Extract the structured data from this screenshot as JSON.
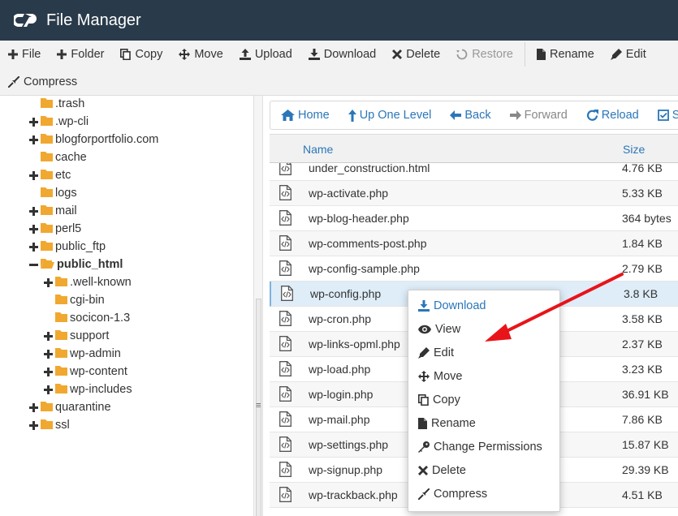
{
  "app": {
    "title": "File Manager"
  },
  "toolbar": {
    "row1": [
      {
        "icon": "plus-icon",
        "label": "File"
      },
      {
        "icon": "plus-icon",
        "label": "Folder"
      },
      {
        "icon": "copy-icon",
        "label": "Copy"
      },
      {
        "icon": "move-icon",
        "label": "Move"
      },
      {
        "icon": "upload-icon",
        "label": "Upload"
      },
      {
        "icon": "download-icon",
        "label": "Download"
      },
      {
        "icon": "close-icon",
        "label": "Delete"
      },
      {
        "icon": "restore-icon",
        "label": "Restore",
        "disabled": true
      },
      {
        "icon": "file-icon",
        "label": "Rename"
      },
      {
        "icon": "pencil-icon",
        "label": "Edit"
      }
    ],
    "row2": [
      {
        "icon": "compress-icon",
        "label": "Compress"
      }
    ]
  },
  "tree": [
    {
      "label": ".trash",
      "level": 0,
      "toggle": "none"
    },
    {
      "label": ".wp-cli",
      "level": 0,
      "toggle": "plus"
    },
    {
      "label": "blogforportfolio.com",
      "level": 0,
      "toggle": "plus"
    },
    {
      "label": "cache",
      "level": 0,
      "toggle": "none"
    },
    {
      "label": "etc",
      "level": 0,
      "toggle": "plus"
    },
    {
      "label": "logs",
      "level": 0,
      "toggle": "none"
    },
    {
      "label": "mail",
      "level": 0,
      "toggle": "plus"
    },
    {
      "label": "perl5",
      "level": 0,
      "toggle": "plus"
    },
    {
      "label": "public_ftp",
      "level": 0,
      "toggle": "plus"
    },
    {
      "label": "public_html",
      "level": 0,
      "toggle": "minus",
      "bold": true,
      "open": true
    },
    {
      "label": ".well-known",
      "level": 1,
      "toggle": "plus"
    },
    {
      "label": "cgi-bin",
      "level": 1,
      "toggle": "none"
    },
    {
      "label": "socicon-1.3",
      "level": 1,
      "toggle": "none"
    },
    {
      "label": "support",
      "level": 1,
      "toggle": "plus"
    },
    {
      "label": "wp-admin",
      "level": 1,
      "toggle": "plus"
    },
    {
      "label": "wp-content",
      "level": 1,
      "toggle": "plus"
    },
    {
      "label": "wp-includes",
      "level": 1,
      "toggle": "plus"
    },
    {
      "label": "quarantine",
      "level": 0,
      "toggle": "plus"
    },
    {
      "label": "ssl",
      "level": 0,
      "toggle": "plus"
    }
  ],
  "nav": [
    {
      "icon": "home-icon",
      "label": "Home"
    },
    {
      "icon": "up-arrow-icon",
      "label": "Up One Level"
    },
    {
      "icon": "back-arrow-icon",
      "label": "Back"
    },
    {
      "icon": "forward-arrow-icon",
      "label": "Forward",
      "disabled": true
    },
    {
      "icon": "reload-icon",
      "label": "Reload"
    },
    {
      "icon": "checkbox-icon",
      "label": "S"
    }
  ],
  "table": {
    "columns": {
      "name": "Name",
      "size": "Size"
    },
    "rows": [
      {
        "name": "under_construction.html",
        "size": "4.76 KB"
      },
      {
        "name": "wp-activate.php",
        "size": "5.33 KB"
      },
      {
        "name": "wp-blog-header.php",
        "size": "364 bytes"
      },
      {
        "name": "wp-comments-post.php",
        "size": "1.84 KB"
      },
      {
        "name": "wp-config-sample.php",
        "size": "2.79 KB"
      },
      {
        "name": "wp-config.php",
        "size": "3.8 KB",
        "selected": true
      },
      {
        "name": "wp-cron.php",
        "size": "3.58 KB"
      },
      {
        "name": "wp-links-opml.php",
        "size": "2.37 KB"
      },
      {
        "name": "wp-load.php",
        "size": "3.23 KB"
      },
      {
        "name": "wp-login.php",
        "size": "36.91 KB"
      },
      {
        "name": "wp-mail.php",
        "size": "7.86 KB"
      },
      {
        "name": "wp-settings.php",
        "size": "15.87 KB"
      },
      {
        "name": "wp-signup.php",
        "size": "29.39 KB"
      },
      {
        "name": "wp-trackback.php",
        "size": "4.51 KB"
      }
    ]
  },
  "context_menu": [
    {
      "icon": "download-icon",
      "label": "Download",
      "primary": true
    },
    {
      "icon": "eye-icon",
      "label": "View"
    },
    {
      "icon": "pencil-icon",
      "label": "Edit"
    },
    {
      "icon": "move-icon",
      "label": "Move"
    },
    {
      "icon": "copy-icon",
      "label": "Copy"
    },
    {
      "icon": "file-icon",
      "label": "Rename"
    },
    {
      "icon": "key-icon",
      "label": "Change Permissions"
    },
    {
      "icon": "close-icon",
      "label": "Delete"
    },
    {
      "icon": "compress-icon",
      "label": "Compress"
    }
  ],
  "colors": {
    "header_bg": "#293a4a",
    "link": "#2a76b9",
    "folder": "#f0a830",
    "annotation_arrow": "#e8141a"
  }
}
